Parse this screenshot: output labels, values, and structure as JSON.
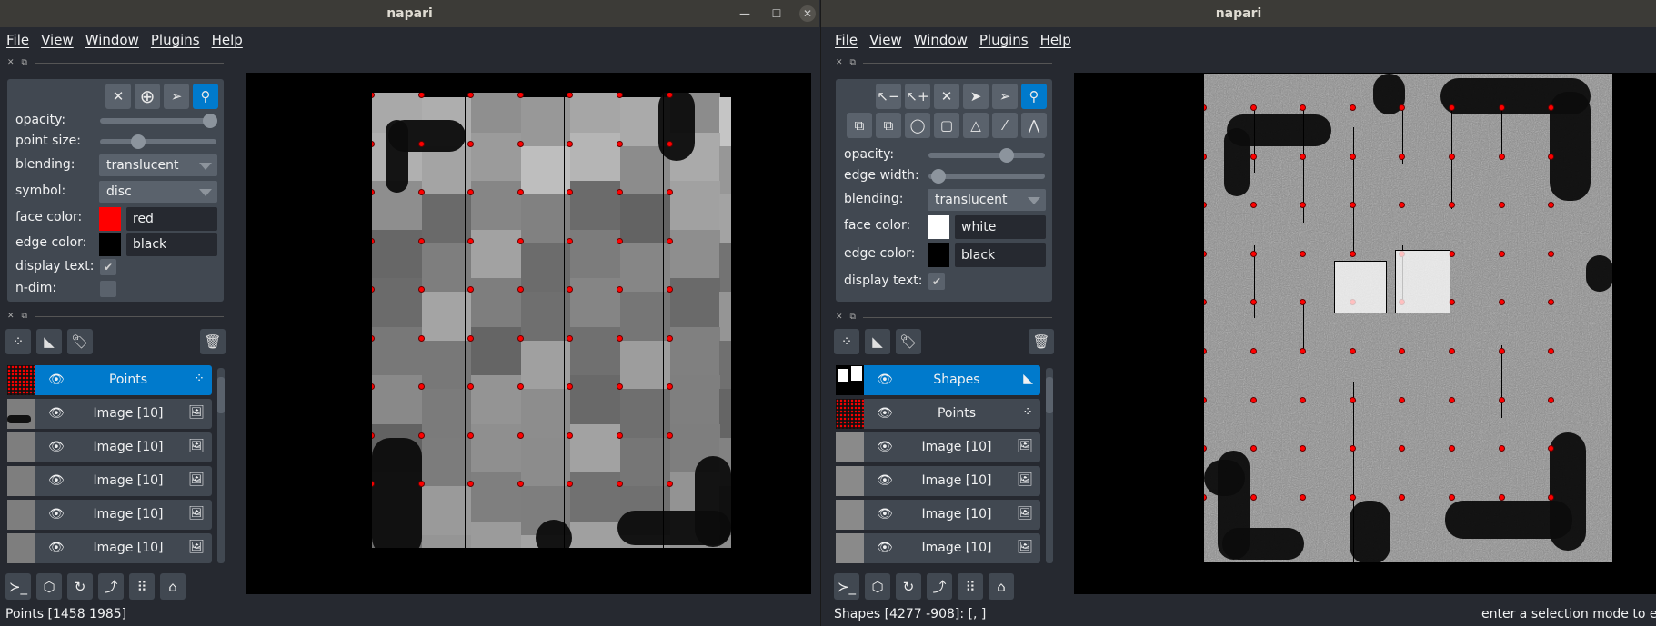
{
  "colors": {
    "accent": "#007acc",
    "panel": "#414851",
    "background": "#262930",
    "points_face": "#ff0000"
  },
  "left": {
    "title": "napari",
    "window_controls": [
      "minimize",
      "maximize",
      "close"
    ],
    "menu": [
      "File",
      "View",
      "Window",
      "Plugins",
      "Help"
    ],
    "tools": [
      {
        "icon": "close-icon",
        "glyph": "✕"
      },
      {
        "icon": "add-point-icon",
        "glyph": "⊕"
      },
      {
        "icon": "select-arrow-icon",
        "glyph": "➢"
      },
      {
        "icon": "zoom-icon",
        "glyph": "🔍",
        "active": true
      }
    ],
    "controls": {
      "opacity_label": "opacity:",
      "opacity": 1.0,
      "point_size_label": "point size:",
      "point_size": 0.3,
      "blending_label": "blending:",
      "blending": "translucent",
      "symbol_label": "symbol:",
      "symbol": "disc",
      "face_color_label": "face color:",
      "face_color": "red",
      "face_hex": "#ff0000",
      "edge_color_label": "edge color:",
      "edge_color": "black",
      "edge_hex": "#000000",
      "display_text_label": "display text:",
      "display_text": true,
      "ndim_label": "n-dim:",
      "ndim": false
    },
    "layers": [
      {
        "name": "Points",
        "type": "points",
        "selected": true
      },
      {
        "name": "Image [10]",
        "type": "image"
      },
      {
        "name": "Image [10]",
        "type": "image"
      },
      {
        "name": "Image [10]",
        "type": "image"
      },
      {
        "name": "Image [10]",
        "type": "image"
      },
      {
        "name": "Image [10]",
        "type": "image"
      }
    ],
    "status": "Points [1458 1985]"
  },
  "right": {
    "title": "napari",
    "menu": [
      "File",
      "View",
      "Window",
      "Plugins",
      "Help"
    ],
    "controls": {
      "opacity_label": "opacity:",
      "opacity": 0.7,
      "edge_width_label": "edge width:",
      "edge_width": 0.1,
      "blending_label": "blending:",
      "blending": "translucent",
      "face_color_label": "face color:",
      "face_color": "white",
      "face_hex": "#ffffff",
      "edge_color_label": "edge color:",
      "edge_color": "black",
      "edge_hex": "#000000",
      "display_text_label": "display text:",
      "display_text": true
    },
    "layers": [
      {
        "name": "Shapes",
        "type": "shapes",
        "selected": true
      },
      {
        "name": "Points",
        "type": "points"
      },
      {
        "name": "Image [10]",
        "type": "image"
      },
      {
        "name": "Image [10]",
        "type": "image"
      },
      {
        "name": "Image [10]",
        "type": "image"
      },
      {
        "name": "Image [10]",
        "type": "image"
      }
    ],
    "status": "Shapes [4277 -908]: [, ]",
    "status_right": "enter a selection mode to e"
  }
}
